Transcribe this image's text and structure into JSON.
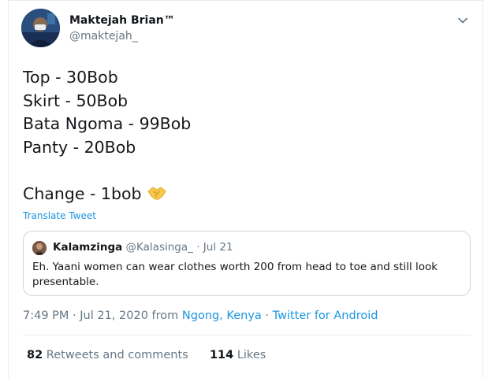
{
  "author": {
    "name": "Maktejah Brian™",
    "handle": "@maktejah_"
  },
  "tweet": {
    "lines": [
      "Top - 30Bob",
      "Skirt - 50Bob",
      "Bata Ngoma - 99Bob",
      "Panty - 20Bob",
      "",
      "Change - 1bob"
    ],
    "emoji": "handshake-emoji",
    "translate_label": "Translate Tweet"
  },
  "quoted": {
    "name": "Kalamzinga",
    "handle": "@Kalasinga_",
    "separator": "·",
    "date": "Jul 21",
    "text": "Eh. Yaani women can wear clothes worth 200 from head to toe and still look presentable."
  },
  "meta": {
    "time": "7:49 PM · Jul 21, 2020 from",
    "location": "Ngong, Kenya",
    "separator": "·",
    "source": "Twitter for Android"
  },
  "stats": {
    "retweets_count": "82",
    "retweets_label": "Retweets and comments",
    "likes_count": "114",
    "likes_label": "Likes"
  },
  "colors": {
    "link": "#1b95e0",
    "secondary_text": "#657786",
    "border": "#e6ecf0"
  }
}
